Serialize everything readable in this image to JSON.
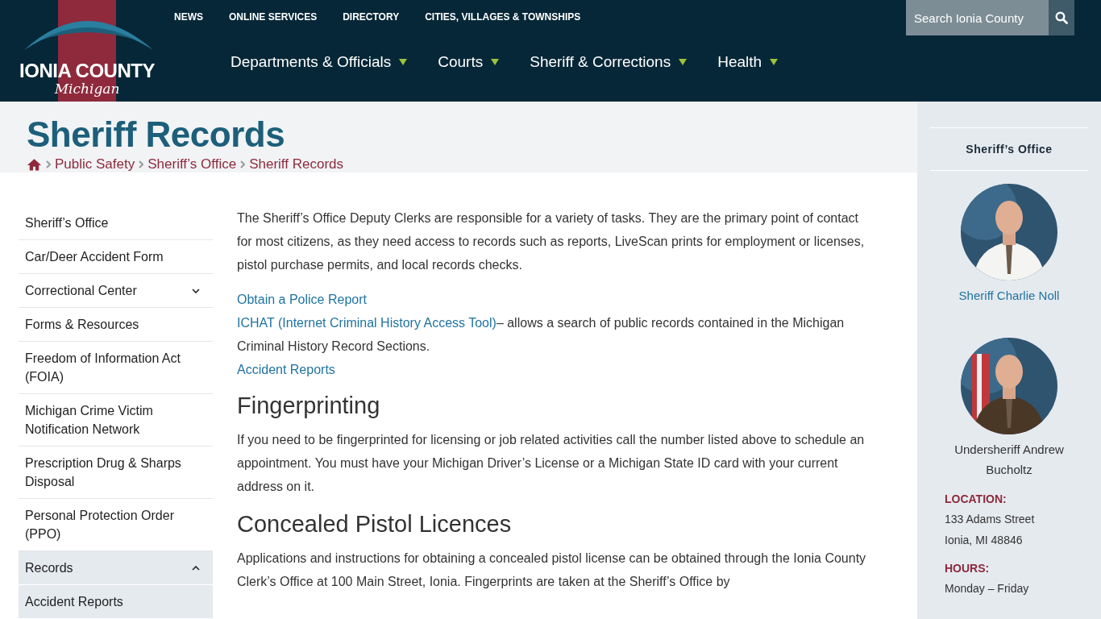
{
  "header": {
    "logo": {
      "name": "IONIA COUNTY",
      "sub": "Michigan"
    },
    "utility_links": [
      "NEWS",
      "ONLINE SERVICES",
      "DIRECTORY",
      "CITIES, VILLAGES & TOWNSHIPS"
    ],
    "main_nav": [
      {
        "label": "Departments & Officials",
        "has_dropdown": true
      },
      {
        "label": "Courts",
        "has_dropdown": true
      },
      {
        "label": "Sheriff & Corrections",
        "has_dropdown": true
      },
      {
        "label": "Health",
        "has_dropdown": true
      }
    ],
    "search": {
      "placeholder": "Search Ionia County"
    }
  },
  "page_title": "Sheriff Records",
  "breadcrumb": [
    "Public Safety",
    "Sheriff’s Office",
    "Sheriff Records"
  ],
  "sidebar": {
    "items": [
      {
        "label": "Sheriff’s Office",
        "kind": "link"
      },
      {
        "label": "Car/Deer Accident Form",
        "kind": "link"
      },
      {
        "label": "Correctional Center",
        "kind": "toggle",
        "expanded": false
      },
      {
        "label": "Forms & Resources",
        "kind": "link"
      },
      {
        "label": "Freedom of Information Act (FOIA)",
        "kind": "link"
      },
      {
        "label": "Michigan Crime Victim Notification Network",
        "kind": "link"
      },
      {
        "label": "Prescription Drug & Sharps Disposal",
        "kind": "link"
      },
      {
        "label": "Personal Protection Order (PPO)",
        "kind": "link"
      },
      {
        "label": "Records",
        "kind": "toggle",
        "expanded": true,
        "children": [
          {
            "label": "Accident Reports"
          }
        ]
      }
    ]
  },
  "content": [
    {
      "kind": "paragraph",
      "text": "The Sheriff’s Office Deputy Clerks are responsible for a variety of tasks. They are the primary point of contact for most citizens, as they need access to records such as reports, LiveScan prints for employment or licenses, pistol purchase permits, and local records checks."
    },
    {
      "kind": "links",
      "lines": [
        {
          "link": "Obtain a Police Report"
        },
        {
          "link": "ICHAT (Internet Criminal History Access Tool)",
          "text": "– allows a search of public records contained in the Michigan Criminal History Record Sections."
        },
        {
          "link": "Accident Reports"
        }
      ]
    },
    {
      "kind": "heading",
      "text": "Fingerprinting"
    },
    {
      "kind": "paragraph",
      "text": "If you need to be fingerprinted for licensing or job related activities call the number listed above to schedule an appointment. You must have your Michigan Driver’s License or a Michigan State ID card with your current address on it."
    },
    {
      "kind": "heading",
      "text": "Concealed Pistol Licences"
    },
    {
      "kind": "paragraph",
      "text": "Applications and instructions for obtaining a concealed pistol license can be obtained through the Ionia County Clerk’s Office at 100 Main Street, Ionia. Fingerprints are taken at the Sheriff’s Office by"
    }
  ],
  "aside": {
    "title": "Sheriff’s Office",
    "staff": [
      {
        "name": "Sheriff Charlie Noll",
        "link": true
      },
      {
        "name": "Undersheriff Andrew Bucholtz",
        "link": false
      }
    ],
    "sections": [
      {
        "label": "LOCATION:",
        "lines": [
          "133 Adams Street",
          "Ionia, MI 48846"
        ]
      },
      {
        "label": "HOURS:",
        "lines": [
          "Monday – Friday"
        ]
      }
    ]
  }
}
